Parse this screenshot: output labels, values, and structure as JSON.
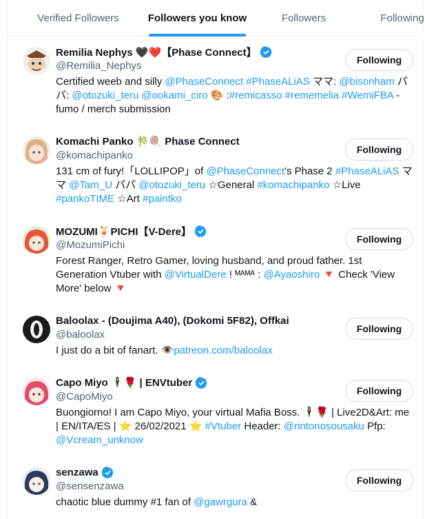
{
  "tabs": [
    {
      "label": "Verified Followers",
      "active": false
    },
    {
      "label": "Followers you know",
      "active": true
    },
    {
      "label": "Followers",
      "active": false
    },
    {
      "label": "Following",
      "active": false
    }
  ],
  "colors": {
    "accent": "#1d9bf0",
    "secondary_text": "#536471",
    "primary_text": "#0f1419",
    "border": "#cfd9de"
  },
  "users": [
    {
      "name": "Remilia Nephys 🖤❤️【Phase Connect】",
      "handle": "@Remilia_Nephys",
      "verified": true,
      "button": "Following",
      "bio": [
        {
          "t": "Certified weeb and silly "
        },
        {
          "t": "@PhaseConnect",
          "link": true
        },
        {
          "t": " "
        },
        {
          "t": "#PhaseALiAS",
          "link": true
        },
        {
          "t": " ママ: "
        },
        {
          "t": "@bisonham",
          "link": true
        },
        {
          "t": " パパ: "
        },
        {
          "t": "@otozuki_teru",
          "link": true
        },
        {
          "t": " "
        },
        {
          "t": "@ookami_ciro",
          "link": true
        },
        {
          "t": " 🎨 :"
        },
        {
          "t": "#remicasso",
          "link": true
        },
        {
          "t": " "
        },
        {
          "t": "#rememelia",
          "link": true
        },
        {
          "t": " "
        },
        {
          "t": "#WemiFBA",
          "link": true
        },
        {
          "t": " - fumo / merch submission"
        }
      ]
    },
    {
      "name": "Komachi Panko 🎋🍭 Phase Connect",
      "handle": "@komachipanko",
      "verified": false,
      "button": "Following",
      "bio": [
        {
          "t": "131 cm of fury!「LOLLIPOP」of "
        },
        {
          "t": "@PhaseConnect",
          "link": true
        },
        {
          "t": "'s Phase 2 "
        },
        {
          "t": "#PhaseALiAS",
          "link": true
        },
        {
          "t": " ママ "
        },
        {
          "t": "@Tam_U",
          "link": true
        },
        {
          "t": " パパ "
        },
        {
          "t": "@otozuki_teru",
          "link": true
        },
        {
          "t": " ☆General "
        },
        {
          "t": "#komachipanko",
          "link": true
        },
        {
          "t": " ☆Live "
        },
        {
          "t": "#pankoTIME",
          "link": true
        },
        {
          "t": " ☆Art "
        },
        {
          "t": "#paintko",
          "link": true
        }
      ]
    },
    {
      "name": "MOZUMI🍹PICHI【V-Dere】",
      "handle": "@MozumiPichi",
      "verified": true,
      "button": "Following",
      "bio": [
        {
          "t": "Forest Ranger, Retro Gamer, loving husband, and proud father. 1st Generation Vtuber with "
        },
        {
          "t": "@VirtualDere",
          "link": true
        },
        {
          "t": " ! ᴹᴬᴹᴬ : "
        },
        {
          "t": "@Ayaoshiro",
          "link": true
        },
        {
          "t": " 🔻 Check 'View More' below 🔻"
        }
      ]
    },
    {
      "name": "Baloolax - (Doujima A40), (Dokomi 5F82), Offkai",
      "handle": "@baloolax",
      "verified": false,
      "button": "Following",
      "bio": [
        {
          "t": "I just do a bit of fanart. 👁️"
        },
        {
          "t": "patreon.com/baloolax",
          "link": true
        }
      ]
    },
    {
      "name": "Capo Miyo 🕴️🌹 | ENVtuber",
      "handle": "@CapoMiyo",
      "verified": true,
      "button": "Following",
      "bio": [
        {
          "t": "Buongiorno! I am Capo Miyo, your virtual Mafia Boss. 🕴️🌹 | Live2D&Art: me | EN/ITA/ES | ⭐ 26/02/2021 ⭐ "
        },
        {
          "t": "#Vtuber",
          "link": true
        },
        {
          "t": " Header: "
        },
        {
          "t": "@rintonosousaku",
          "link": true
        },
        {
          "t": " Pfp: "
        },
        {
          "t": "@Vcream_unknow",
          "link": true
        }
      ]
    },
    {
      "name": "senzawa",
      "handle": "@sensenzawa",
      "verified": true,
      "button": "Following",
      "bio": [
        {
          "t": "chaotic blue dummy #1 fan of "
        },
        {
          "t": "@gawrgura",
          "link": true
        },
        {
          "t": " &"
        }
      ]
    }
  ]
}
